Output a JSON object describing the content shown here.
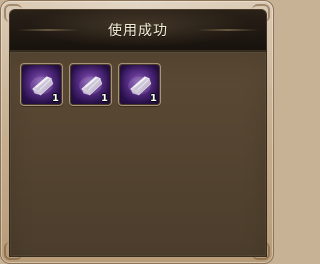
{
  "dialog": {
    "title": "使用成功"
  },
  "items": [
    {
      "icon": "crystal-shard-icon",
      "count": "1"
    },
    {
      "icon": "crystal-shard-icon",
      "count": "1"
    },
    {
      "icon": "crystal-shard-icon",
      "count": "1"
    }
  ],
  "colors": {
    "frame": "#c7b296",
    "header": "#1f1711",
    "content_panel": "#55452f",
    "slot_background": "#3b2b20",
    "item_purple": "#6f42a0",
    "title_text": "#f3ecd8"
  }
}
